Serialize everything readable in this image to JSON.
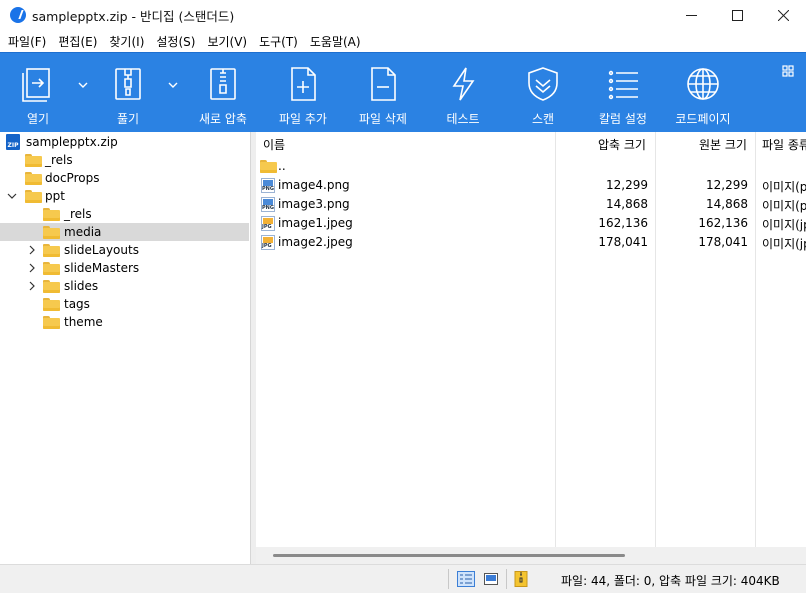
{
  "window": {
    "title": "samplepptx.zip - 반디집 (스탠더드)",
    "minimize": "minimize",
    "maximize": "maximize",
    "close": "close"
  },
  "menu": [
    {
      "label": "파일(F)"
    },
    {
      "label": "편집(E)"
    },
    {
      "label": "찾기(I)"
    },
    {
      "label": "설정(S)"
    },
    {
      "label": "보기(V)"
    },
    {
      "label": "도구(T)"
    },
    {
      "label": "도움말(A)"
    }
  ],
  "toolbar": {
    "open": "열기",
    "extract": "풀기",
    "new_archive": "새로 압축",
    "add_file": "파일 추가",
    "delete_file": "파일 삭제",
    "test": "테스트",
    "scan": "스캔",
    "column_settings": "칼럼 설정",
    "codepage": "코드페이지"
  },
  "tree": {
    "root": "samplepptx.zip",
    "zip_badge": "ZIP",
    "items": [
      {
        "label": "_rels"
      },
      {
        "label": "docProps"
      },
      {
        "label": "ppt"
      },
      {
        "label": "_rels"
      },
      {
        "label": "media"
      },
      {
        "label": "slideLayouts"
      },
      {
        "label": "slideMasters"
      },
      {
        "label": "slides"
      },
      {
        "label": "tags"
      },
      {
        "label": "theme"
      }
    ]
  },
  "filelist": {
    "columns": {
      "name": "이름",
      "compressed": "압축 크기",
      "original": "원본 크기",
      "type": "파일 종류"
    },
    "parent": "..",
    "rows": [
      {
        "name": "image4.png",
        "compressed": "12,299",
        "original": "12,299",
        "type": "이미지(png)",
        "ext": "PNG"
      },
      {
        "name": "image3.png",
        "compressed": "14,868",
        "original": "14,868",
        "type": "이미지(png)",
        "ext": "PNG"
      },
      {
        "name": "image1.jpeg",
        "compressed": "162,136",
        "original": "162,136",
        "type": "이미지(jpeg)",
        "ext": "JPG"
      },
      {
        "name": "image2.jpeg",
        "compressed": "178,041",
        "original": "178,041",
        "type": "이미지(jpeg)",
        "ext": "JPG"
      }
    ]
  },
  "status": {
    "summary": "파일: 44, 폴더: 0, 압축 파일 크기: 404KB"
  },
  "colors": {
    "toolbar": "#2b82e3",
    "folder": "#f6c94e",
    "selection": "#d9d9d9"
  }
}
